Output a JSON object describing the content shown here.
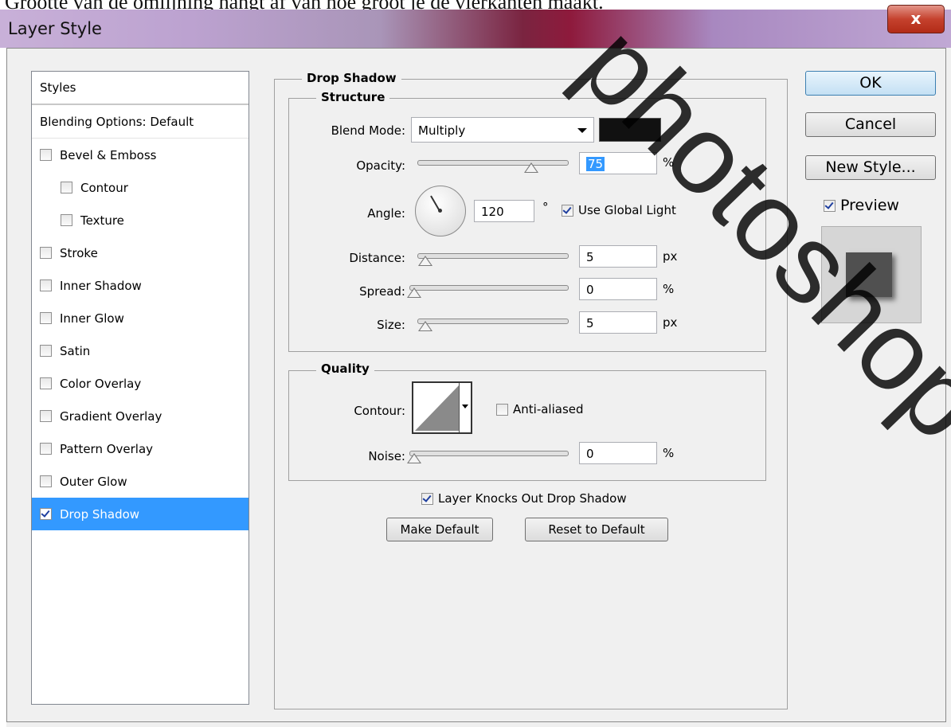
{
  "caption": "Grootte van de omlijning hangt af van hoe groot je de vierkanten maakt.",
  "window": {
    "title": "Layer Style",
    "close_glyph": "x"
  },
  "styles_panel": {
    "header": "Styles",
    "blending": "Blending Options: Default",
    "items": [
      {
        "label": "Bevel & Emboss",
        "checked": false
      },
      {
        "label": "Contour",
        "checked": false
      },
      {
        "label": "Texture",
        "checked": false
      },
      {
        "label": "Stroke",
        "checked": false
      },
      {
        "label": "Inner Shadow",
        "checked": false
      },
      {
        "label": "Inner Glow",
        "checked": false
      },
      {
        "label": "Satin",
        "checked": false
      },
      {
        "label": "Color Overlay",
        "checked": false
      },
      {
        "label": "Gradient Overlay",
        "checked": false
      },
      {
        "label": "Pattern Overlay",
        "checked": false
      },
      {
        "label": "Outer Glow",
        "checked": false
      },
      {
        "label": "Drop Shadow",
        "checked": true
      }
    ]
  },
  "drop_shadow": {
    "title": "Drop Shadow",
    "structure": {
      "title": "Structure",
      "blend_mode_label": "Blend Mode:",
      "blend_mode_value": "Multiply",
      "shadow_color": "#111111",
      "opacity_label": "Opacity:",
      "opacity_value": "75",
      "opacity_unit": "%",
      "angle_label": "Angle:",
      "angle_value": "120",
      "angle_unit": "°",
      "use_global_light": "Use Global Light",
      "distance_label": "Distance:",
      "distance_value": "5",
      "distance_unit": "px",
      "spread_label": "Spread:",
      "spread_value": "0",
      "spread_unit": "%",
      "size_label": "Size:",
      "size_value": "5",
      "size_unit": "px"
    },
    "quality": {
      "title": "Quality",
      "contour_label": "Contour:",
      "anti_aliased": "Anti-aliased",
      "noise_label": "Noise:",
      "noise_value": "0",
      "noise_unit": "%"
    },
    "knocks_out": "Layer Knocks Out Drop Shadow",
    "make_default": "Make Default",
    "reset_default": "Reset to Default"
  },
  "buttons": {
    "ok": "OK",
    "cancel": "Cancel",
    "new_style": "New Style...",
    "preview": "Preview"
  },
  "watermark": "photoshop"
}
